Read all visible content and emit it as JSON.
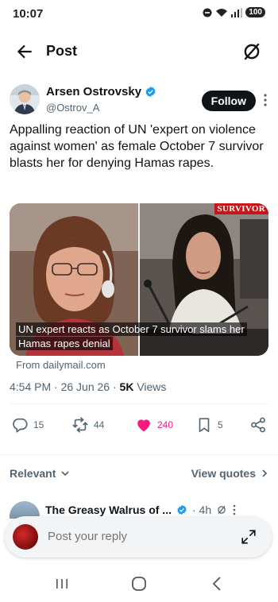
{
  "status": {
    "time": "10:07",
    "battery": "100"
  },
  "header": {
    "title": "Post"
  },
  "author": {
    "name": "Arsen Ostrovsky",
    "handle": "@Ostrov_A",
    "follow_label": "Follow"
  },
  "tweet": {
    "text": "Appalling reaction of UN 'expert on violence against women' as female October 7 survivor blasts her for denying Hamas rapes.",
    "media": {
      "tag": "SURVIVOR",
      "caption": "UN expert reacts as October 7 survivor slams her Hamas rapes denial"
    },
    "source": "From dailymail.com",
    "timestamp": "4:54 PM · 26 Jun 26 · ",
    "views_count": "5K",
    "views_label": " Views"
  },
  "actions": {
    "replies": "15",
    "reposts": "44",
    "likes": "240",
    "bookmarks": "5"
  },
  "colors": {
    "like": "#f91880",
    "text": "#0f1419",
    "muted": "#536471"
  },
  "sort": {
    "relevant_label": "Relevant",
    "view_quotes_label": "View quotes"
  },
  "reply_preview": {
    "name": "The Greasy Walrus of ...",
    "time": "· 4h"
  },
  "compose": {
    "placeholder": "Post your reply"
  }
}
